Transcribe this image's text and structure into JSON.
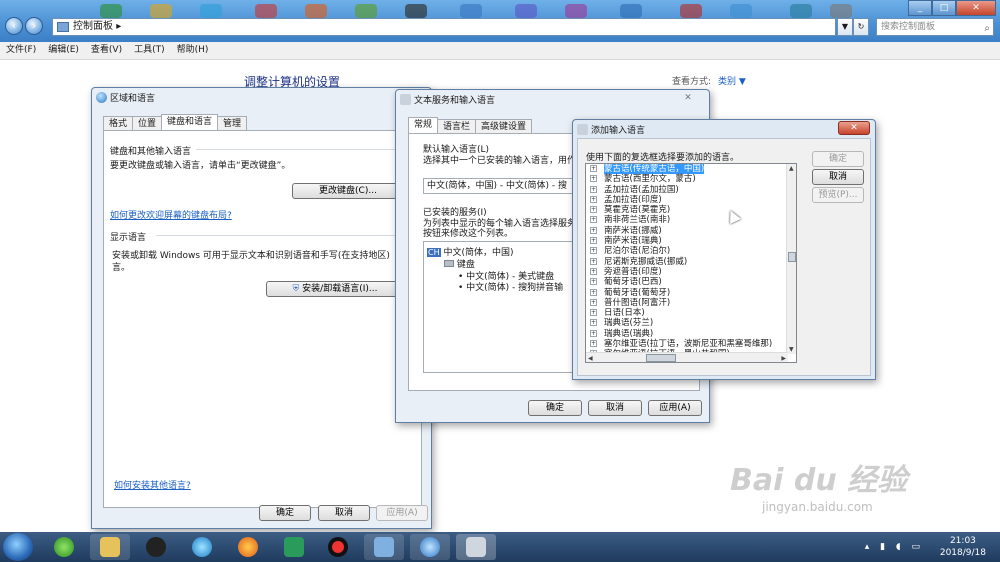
{
  "explorer": {
    "breadcrumb": "控制面板",
    "search_placeholder": "搜索控制面板",
    "menu": [
      "文件(F)",
      "编辑(E)",
      "查看(V)",
      "工具(T)",
      "帮助(H)"
    ],
    "heading": "调整计算机的设置",
    "view_label": "查看方式:",
    "view_value": "类别 ▼"
  },
  "region_dialog": {
    "title": "区域和语言",
    "tabs": [
      "格式",
      "位置",
      "键盘和语言",
      "管理"
    ],
    "keyboard_section": "键盘和其他输入语言",
    "keyboard_desc": "要更改键盘或输入语言，请单击“更改键盘”。",
    "change_keyboard_button": "更改键盘(C)...",
    "onscreen_link": "如何更改欢迎屏幕的键盘布局?",
    "display_section": "显示语言",
    "display_desc_1": "安装或卸载 Windows 可用于显示文本和识别语音和手写(在支持地区)",
    "display_desc_2": "言。",
    "install_button": "安装/卸载语言(I)...",
    "more_languages_link": "如何安装其他语言?",
    "ok": "确定",
    "cancel": "取消",
    "apply": "应用(A)"
  },
  "text_services_dialog": {
    "title": "文本服务和输入语言",
    "tabs": [
      "常规",
      "语言栏",
      "高级键设置"
    ],
    "default_section": "默认输入语言(L)",
    "default_desc": "选择其中一个已安装的输入语言，用作",
    "default_value": "中文(简体，中国) - 中文(简体) - 搜",
    "installed_section": "已安装的服务(I)",
    "installed_desc_1": "为列表中显示的每个输入语言选择服务",
    "installed_desc_2": "按钮来修改这个列表。",
    "tree": {
      "lang_badge": "CH",
      "language": "中文(简体，中国)",
      "keyboard": "键盘",
      "items": [
        "• 中文(简体) - 美式键盘",
        "• 中文(简体) - 搜狗拼音输"
      ]
    },
    "ok": "确定",
    "cancel": "取消",
    "apply": "应用(A)"
  },
  "add_language_dialog": {
    "title": "添加输入语言",
    "instruction": "使用下面的复选框选择要添加的语言。",
    "languages": [
      "蒙古语(传统蒙古语，中国)",
      "蒙古语(西里尔文，蒙古)",
      "孟加拉语(孟加拉国)",
      "孟加拉语(印度)",
      "莫霍克语(莫霍克)",
      "南非荷兰语(南非)",
      "南萨米语(挪威)",
      "南萨米语(瑞典)",
      "尼泊尔语(尼泊尔)",
      "尼诺斯克挪威语(挪威)",
      "旁遮普语(印度)",
      "葡萄牙语(巴西)",
      "葡萄牙语(葡萄牙)",
      "普什图语(阿富汗)",
      "日语(日本)",
      "瑞典语(芬兰)",
      "瑞典语(瑞典)",
      "塞尔维亚语(拉丁语，波斯尼亚和黑塞哥维那)",
      "塞尔维亚语(拉丁语，黑山共和国)"
    ],
    "selected_index": 0,
    "ok": "确定",
    "cancel": "取消",
    "preview": "预览(P)..."
  },
  "taskbar": {
    "time": "21:03",
    "date": "2018/9/18"
  },
  "watermark": {
    "main": "Bai du 经验",
    "sub": "jingyan.baidu.com"
  }
}
